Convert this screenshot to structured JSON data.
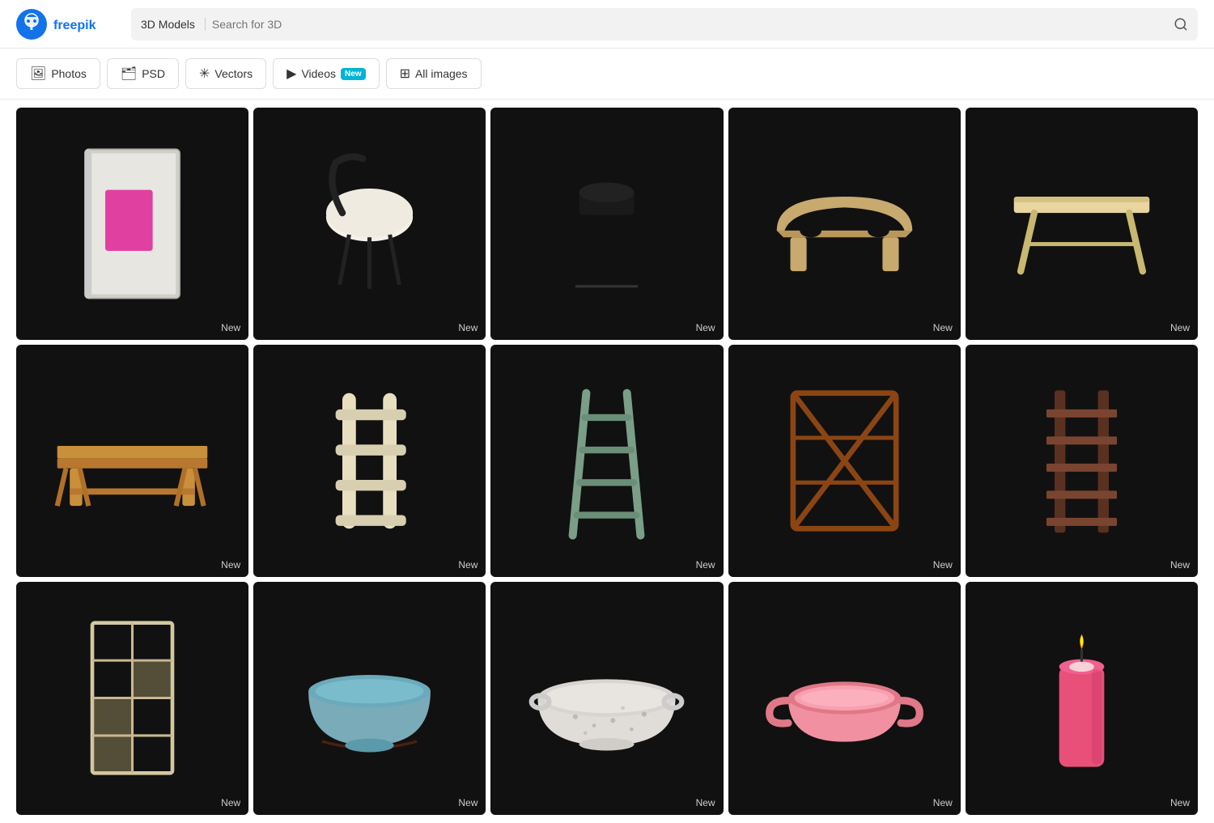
{
  "header": {
    "logo_alt": "Freepik",
    "search_category": "3D Models",
    "search_placeholder": "Search for 3D"
  },
  "nav": {
    "tabs": [
      {
        "id": "photos",
        "label": "Photos",
        "icon": "photo-icon",
        "badge": ""
      },
      {
        "id": "psd",
        "label": "PSD",
        "icon": "psd-icon",
        "badge": ""
      },
      {
        "id": "vectors",
        "label": "Vectors",
        "icon": "vectors-icon",
        "badge": ""
      },
      {
        "id": "videos",
        "label": "Videos",
        "icon": "videos-icon",
        "badge": "New"
      },
      {
        "id": "all-images",
        "label": "All images",
        "icon": "all-images-icon",
        "badge": ""
      }
    ]
  },
  "grid": {
    "badge_label": "New",
    "items": [
      {
        "id": "item-1",
        "type": "notebook",
        "desc": "Gray notebook with pink label"
      },
      {
        "id": "item-2",
        "type": "stool",
        "desc": "Modern black and white bar stool"
      },
      {
        "id": "item-3",
        "type": "barstool-dark",
        "desc": "Black bar stool"
      },
      {
        "id": "item-4",
        "type": "wooden-table-small",
        "desc": "Small wooden table"
      },
      {
        "id": "item-5",
        "type": "folding-table",
        "desc": "Folding wooden table"
      },
      {
        "id": "item-6",
        "type": "bench",
        "desc": "Wooden bench"
      },
      {
        "id": "item-7",
        "type": "shelf-beige",
        "desc": "Beige decorative shelf"
      },
      {
        "id": "item-8",
        "type": "ladder-shelf-green",
        "desc": "Green ladder shelf"
      },
      {
        "id": "item-9",
        "type": "xshelf-brown",
        "desc": "Brown X-frame shelf"
      },
      {
        "id": "item-10",
        "type": "tiered-shelf-dark",
        "desc": "Dark tiered shelf"
      },
      {
        "id": "item-11",
        "type": "modular-bookcase",
        "desc": "Modular white bookcase"
      },
      {
        "id": "item-12",
        "type": "blue-bowl",
        "desc": "Blue ceramic bowl"
      },
      {
        "id": "item-13",
        "type": "speckled-bowl",
        "desc": "White speckled bowl"
      },
      {
        "id": "item-14",
        "type": "pink-bowl",
        "desc": "Pink oval bowl with handles"
      },
      {
        "id": "item-15",
        "type": "candle",
        "desc": "Pink pillar candle"
      }
    ]
  }
}
